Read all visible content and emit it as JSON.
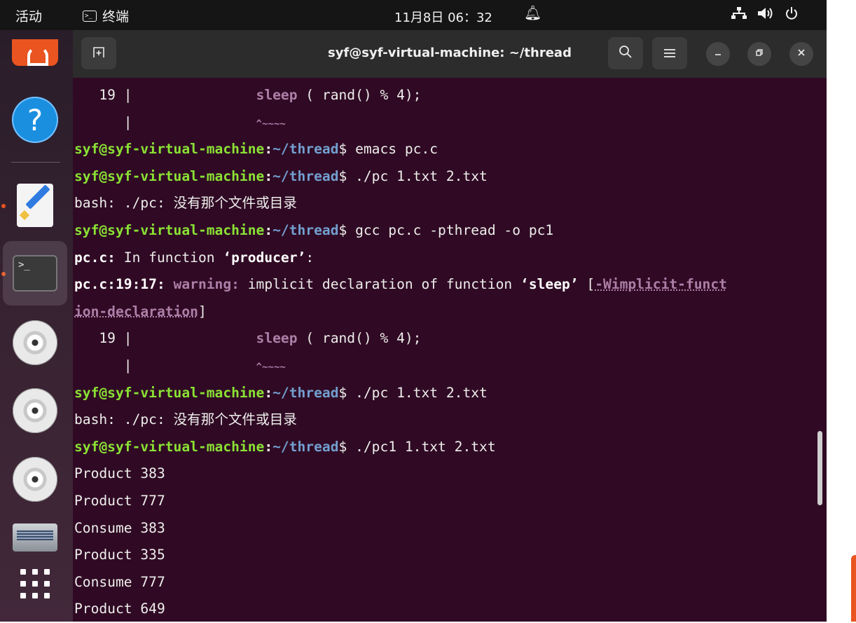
{
  "topbar": {
    "activities": "活动",
    "app_name": "终端",
    "clock": "11月8日  06：32",
    "icons": [
      "network-icon",
      "volume-icon",
      "power-icon"
    ]
  },
  "dock": {
    "items": [
      "software-store",
      "help",
      "text-editor",
      "terminal",
      "disc-1",
      "disc-2",
      "disc-3",
      "drive",
      "show-applications"
    ]
  },
  "window": {
    "title": "syf@syf-virtual-machine: ~/thread",
    "buttons": [
      "new-tab",
      "search",
      "menu",
      "minimize",
      "restore",
      "close"
    ]
  },
  "prompt": {
    "user": "syf@syf-virtual-machine",
    "colon": ":",
    "path": "~/thread",
    "dollar": "$"
  },
  "terminal": {
    "l1_num": "   19 |",
    "l1_fn": "sleep",
    "l1_rest": " ( rand() % 4);",
    "l2_bar": "      |",
    "l2_caret": "^~~~~",
    "l3_cmd": " emacs pc.c",
    "l4_cmd": " ./pc 1.txt 2.txt",
    "l5_prefix": "bash: ./pc: ",
    "l5_msg": "没有那个文件或目录",
    "l6_cmd": " gcc pc.c -pthread -o pc1",
    "l7_file": "pc.c:",
    "l7_mid": " In function ",
    "l7_fn": "‘producer’",
    "l7_end": ":",
    "l8_loc": "pc.c:19:17:",
    "l8_warn": " warning:",
    "l8_mid": " implicit declaration of function ",
    "l8_fn": "‘sleep’",
    "l8_open": " [",
    "l8_flag": "-Wimplicit-funct",
    "l9_flag": "ion-declaration",
    "l9_close": "]",
    "l10_num": "   19 |",
    "l10_fn": "sleep",
    "l10_rest": " ( rand() % 4);",
    "l11_bar": "      |",
    "l11_caret": "^~~~~",
    "l12_cmd": " ./pc 1.txt 2.txt",
    "l13_prefix": "bash: ./pc: ",
    "l13_msg": "没有那个文件或目录",
    "l14_cmd": " ./pc1 1.txt 2.txt",
    "output": [
      "Product 383",
      "Product 777",
      "Consume 383",
      "Product 335",
      "Consume 777",
      "Product 649"
    ]
  }
}
